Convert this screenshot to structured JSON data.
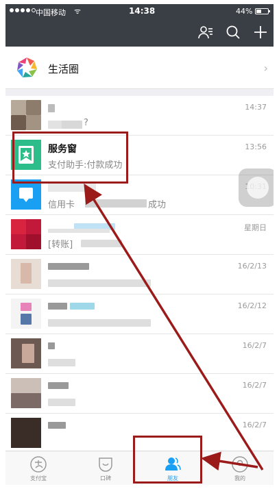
{
  "status": {
    "carrier": "中国移动",
    "wifi": "ᯤ",
    "time": "14:38",
    "battery": "44%",
    "battery_level": 0.44
  },
  "header": {
    "icons": [
      "contacts-icon",
      "search-icon",
      "add-icon"
    ]
  },
  "life": {
    "label": "生活圈",
    "chevron": "›"
  },
  "chats": [
    {
      "title": "",
      "subtitle": "?",
      "time": "14:37"
    },
    {
      "title": "服务窗",
      "subtitle": "支付助手:付款成功",
      "time": "13:56"
    },
    {
      "title": "",
      "subtitle": "信用卡",
      "subtitle_end": "成功",
      "time": "10:31"
    },
    {
      "title": "",
      "subtitle": "[转账]",
      "time": "星期日"
    },
    {
      "title": "",
      "subtitle": "",
      "time": "16/2/13"
    },
    {
      "title": "",
      "subtitle": "",
      "time": "16/2/12"
    },
    {
      "title": "",
      "subtitle": "",
      "time": "16/2/7"
    },
    {
      "title": "",
      "subtitle": "",
      "time": "16/2/7"
    },
    {
      "title": "",
      "subtitle": "",
      "time": "16/2/7"
    }
  ],
  "tabs": [
    {
      "label": "支付宝"
    },
    {
      "label": "口碑"
    },
    {
      "label": "朋友"
    },
    {
      "label": "我的"
    }
  ],
  "colors": {
    "header": "#3a3f45",
    "accent": "#1aa0f2",
    "annotation": "#9b1b1b",
    "service_green": "#2dbd8a"
  }
}
